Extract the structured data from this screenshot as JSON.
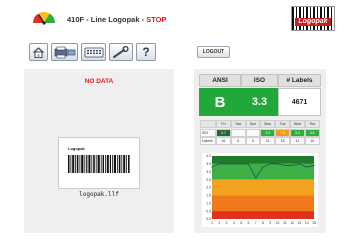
{
  "header": {
    "title_prefix": "410F - Line Logopak - ",
    "status": "STOP",
    "brand_name": "Logopak",
    "gauge_icon": "speedometer-gauge-icon"
  },
  "toolbar": {
    "buttons": [
      {
        "name": "home-icon"
      },
      {
        "name": "printer-settings-icon"
      },
      {
        "name": "keyboard-icon"
      },
      {
        "name": "wrench-icon"
      },
      {
        "name": "help-icon",
        "label": "?"
      }
    ]
  },
  "left_panel": {
    "status_text": "NO DATA",
    "label_preview_title": "Logopak",
    "label_file": "logopak.llf"
  },
  "logout_label": "LOGOUT",
  "metrics": {
    "headers": [
      "ANSI",
      "ISO",
      "# Labels"
    ],
    "ansi_grade": "B",
    "iso_value": "3.3",
    "label_count": "4671",
    "colors": {
      "good": "#22a83a",
      "warn": "#f39a1e",
      "bad": "#e02020"
    }
  },
  "weekly": {
    "days": [
      "Fri",
      "Sat",
      "Sun",
      "Mon",
      "Tue",
      "Wed",
      "Thu"
    ],
    "iso_label": "ISO",
    "labels_label": "Labels",
    "iso": [
      "3.7",
      "",
      "",
      "3.5",
      "2.8",
      "3.4",
      "3.6"
    ],
    "iso_status": [
      "dark",
      "",
      "",
      "green",
      "orange",
      "green",
      "green"
    ],
    "labels": [
      "16",
      "0",
      "0",
      "11",
      "15",
      "11",
      "10"
    ]
  },
  "chart_data": {
    "type": "line",
    "x": [
      1,
      2,
      3,
      4,
      5,
      6,
      7,
      8,
      9,
      10,
      11,
      12,
      13,
      14,
      15
    ],
    "values": [
      3.3,
      3.5,
      3.5,
      3.5,
      3.5,
      3.5,
      2.6,
      3.3,
      3.5,
      3.5,
      3.4,
      3.4,
      3.5,
      3.3,
      3.4
    ],
    "ylim": [
      0,
      4
    ],
    "x_ticks": [
      "1",
      "2",
      "3",
      "4",
      "5",
      "6",
      "7",
      "8",
      "9",
      "10",
      "11",
      "12",
      "13",
      "14",
      "15"
    ],
    "y_ticks": [
      "0.0",
      "0.5",
      "1.0",
      "1.5",
      "2.0",
      "2.5",
      "3.0",
      "3.5",
      "4.0"
    ],
    "bands": [
      {
        "from": 3.5,
        "to": 4.0,
        "color": "#1f7a2a"
      },
      {
        "from": 2.5,
        "to": 3.5,
        "color": "#3cb043"
      },
      {
        "from": 1.5,
        "to": 2.5,
        "color": "#f3a21e"
      },
      {
        "from": 0.5,
        "to": 1.5,
        "color": "#f07a1a"
      },
      {
        "from": 0.0,
        "to": 0.5,
        "color": "#e0301e"
      }
    ],
    "line_color": "#2a4a6a",
    "title": "",
    "xlabel": "",
    "ylabel": ""
  }
}
